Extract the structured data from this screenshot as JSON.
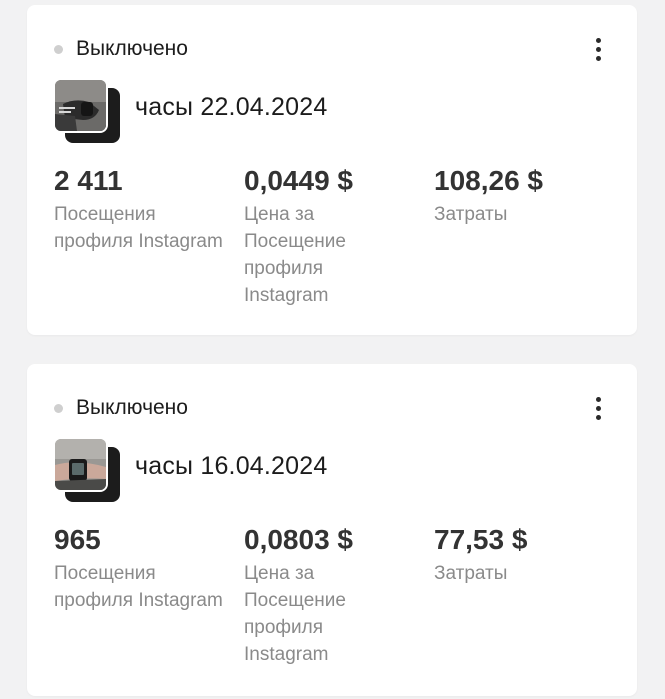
{
  "cards": [
    {
      "status": "Выключено",
      "campaign_name": "часы 22.04.2024",
      "metrics": [
        {
          "value": "2 411",
          "label": "Посещения профиля Instagram"
        },
        {
          "value": "0,0449 $",
          "label": "Цена за Посещение профиля Instagram"
        },
        {
          "value": "108,26 $",
          "label": "Затраты"
        }
      ]
    },
    {
      "status": "Выключено",
      "campaign_name": "часы 16.04.2024",
      "metrics": [
        {
          "value": "965",
          "label": "Посещения профиля Instagram"
        },
        {
          "value": "0,0803 $",
          "label": "Цена за Посещение профиля Instagram"
        },
        {
          "value": "77,53 $",
          "label": "Затраты"
        }
      ]
    }
  ],
  "colors": {
    "background": "#f2f2f3",
    "card": "#ffffff",
    "status_dot_inactive": "#cfcfcf",
    "value_text": "#333333",
    "label_text": "#8a8a8a"
  },
  "icons": {
    "status": "status-dot-icon",
    "more": "more-vertical-icon"
  }
}
